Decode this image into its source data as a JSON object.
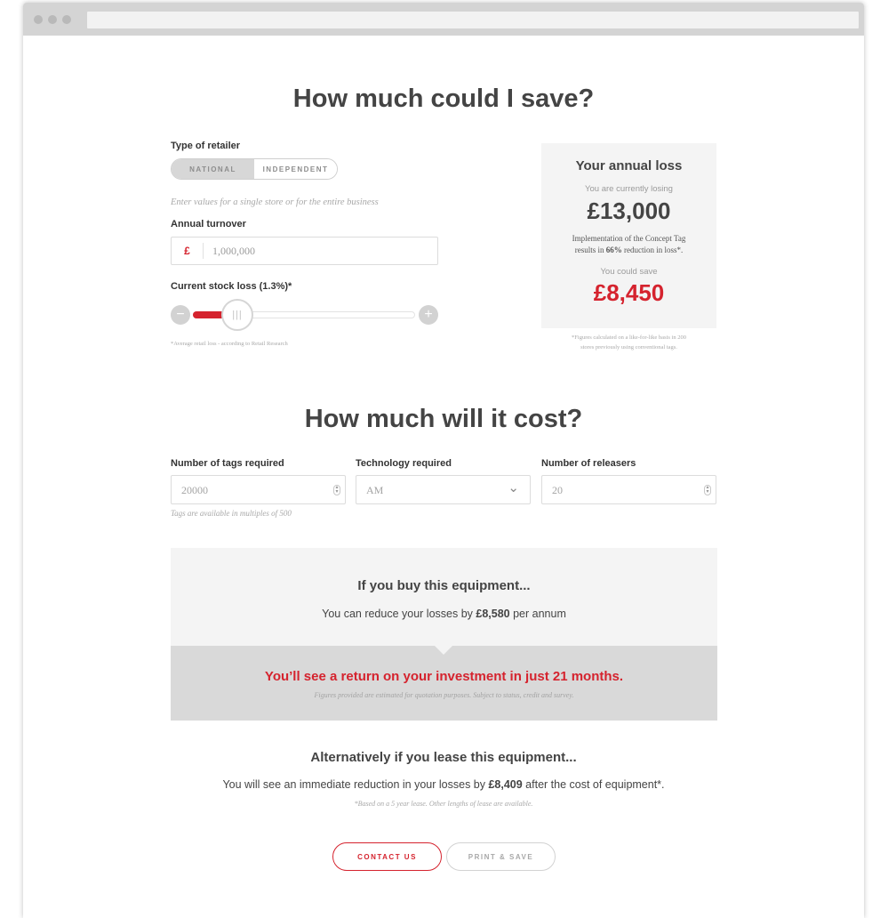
{
  "save_section": {
    "title": "How much could I save?",
    "retailer_label": "Type of retailer",
    "toggle_options": [
      "NATIONAL",
      "INDEPENDENT"
    ],
    "selected_retailer": "NATIONAL",
    "hint": "Enter values for a single store or for the entire business",
    "turnover_label": "Annual turnover",
    "currency_symbol": "£",
    "turnover_value": "1,000,000",
    "stock_loss_label": "Current stock loss (1.3%)*",
    "minus_symbol": "−",
    "plus_symbol": "+",
    "slider_grip": "|||",
    "slider_level_fraction": 0.18,
    "footnote": "*Average retail loss - according to Retail Research"
  },
  "loss_box": {
    "title": "Your annual loss",
    "currently_losing_label": "You are currently losing",
    "current_loss": "£13,000",
    "implementation_line1": "Implementation of the Concept Tag",
    "implementation_line2_pre": "results in ",
    "implementation_pct": "66%",
    "implementation_line2_post": " reduction in loss*.",
    "could_save_label": "You could save",
    "could_save_value": "£8,450",
    "footnote_line1": "*Figures calculated on a like-for-like basis in 200",
    "footnote_line2": "stores previously using conventional tags."
  },
  "cost_section": {
    "title": "How much will it cost?",
    "tags_label": "Number of tags required",
    "tags_value": "20000",
    "tags_hint": "Tags are available in multiples of 500",
    "tech_label": "Technology required",
    "tech_value": "AM",
    "releasers_label": "Number of releasers",
    "releasers_value": "20",
    "spin_up": "▴",
    "spin_down": "▾",
    "chevron": "⌄"
  },
  "buy_box": {
    "heading": "If you buy this equipment...",
    "reduce_pre": "You can reduce your losses by ",
    "reduce_amount": "£8,580",
    "reduce_post": " per annum",
    "return_text": "You’ll see a return on your investment in just 21 months.",
    "disclaimer": "Figures provided are estimated for quotation purposes. Subject to status, credit and survey."
  },
  "lease_section": {
    "heading": "Alternatively if you lease this equipment...",
    "text_pre": "You will see an immediate reduction in your losses by ",
    "amount": "£8,409",
    "text_post": " after the cost of equipment*.",
    "footnote": "*Based on a 5 year lease. Other lengths of lease are available."
  },
  "buttons": {
    "contact": "CONTACT US",
    "print": "PRINT & SAVE"
  },
  "colors": {
    "accent": "#d5232e",
    "panel": "#f4f4f4",
    "panel_dark": "#d9d9d9"
  }
}
